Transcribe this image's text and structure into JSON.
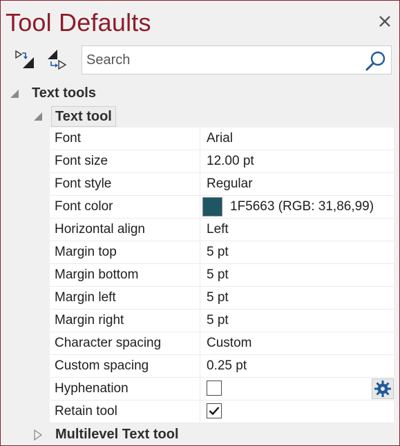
{
  "window": {
    "title": "Tool Defaults",
    "close_icon": "close-icon"
  },
  "toolbar": {
    "expand_all_icon": "expand-all-icon",
    "collapse_all_icon": "collapse-all-icon"
  },
  "search": {
    "placeholder": "Search",
    "value": "",
    "icon": "search-icon"
  },
  "tree": {
    "group_label": "Text tools",
    "tool_label": "Text tool",
    "collapsed_tool_label": "Multilevel Text tool"
  },
  "properties": {
    "font": {
      "name": "Font",
      "value": "Arial"
    },
    "font_size": {
      "name": "Font size",
      "value": "12.00 pt"
    },
    "font_style": {
      "name": "Font style",
      "value": "Regular"
    },
    "font_color": {
      "name": "Font color",
      "value": "1F5663 (RGB: 31,86,99)",
      "swatch": "#1F5663"
    },
    "horizontal_align": {
      "name": "Horizontal align",
      "value": "Left"
    },
    "margin_top": {
      "name": "Margin top",
      "value": "5 pt"
    },
    "margin_bottom": {
      "name": "Margin bottom",
      "value": "5 pt"
    },
    "margin_left": {
      "name": "Margin left",
      "value": "5 pt"
    },
    "margin_right": {
      "name": "Margin right",
      "value": "5 pt"
    },
    "character_spacing": {
      "name": "Character spacing",
      "value": "Custom"
    },
    "custom_spacing": {
      "name": "Custom spacing",
      "value": "0.25 pt"
    },
    "hyphenation": {
      "name": "Hyphenation",
      "checked": false,
      "settings_icon": "gear-icon"
    },
    "retain_tool": {
      "name": "Retain tool",
      "checked": true
    }
  },
  "colors": {
    "title": "#8C1D2A",
    "border": "#8C1D2A",
    "icon_blue": "#1F5A9A"
  }
}
